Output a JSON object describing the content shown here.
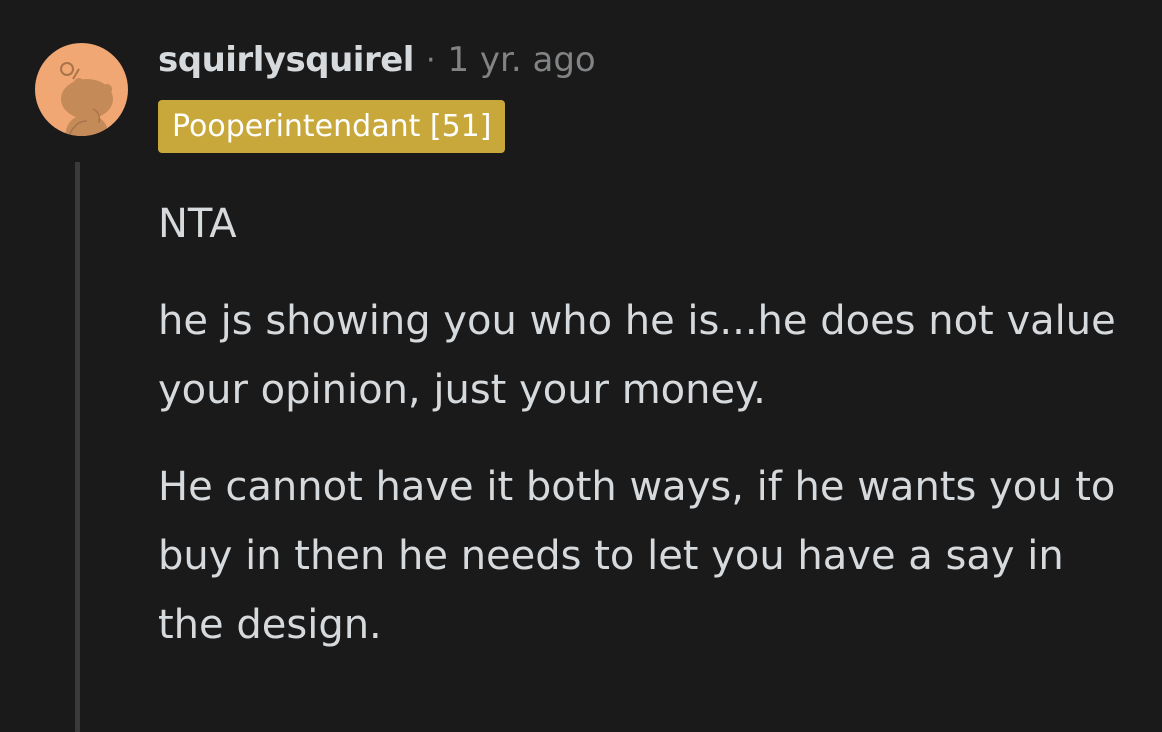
{
  "comment": {
    "author": "squirlysquirel",
    "separator": "·",
    "timestamp": "1 yr. ago",
    "flair": "Pooperintendant [51]",
    "paragraphs": [
      "NTA",
      "he js showing you who he is...he does not value your opinion, just your money.",
      "He cannot have it both ways, if he wants you to buy in then he needs to let you have a say in the design."
    ],
    "avatar_icon": "snoo-avatar-icon"
  },
  "colors": {
    "background": "#1a1a1b",
    "text": "#d7dadc",
    "muted": "#818384",
    "flair_bg": "#c8a83a",
    "avatar_bg": "#f0a773",
    "thread_line": "#3a3a3c"
  }
}
